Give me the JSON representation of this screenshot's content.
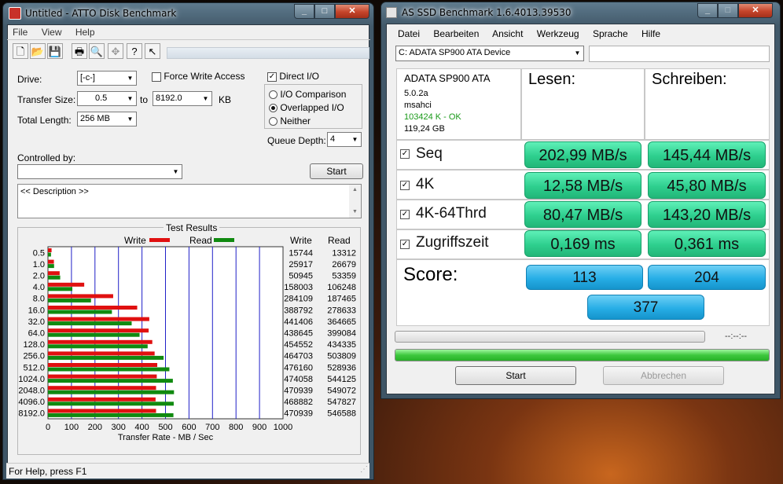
{
  "atto": {
    "title": "Untitled - ATTO Disk Benchmark",
    "menu": [
      "File",
      "View",
      "Help"
    ],
    "drive_label": "Drive:",
    "drive_value": "[-c-]",
    "force_write": "Force Write Access",
    "direct_io": "Direct I/O",
    "transfer_size_label": "Transfer Size:",
    "ts_from": "0.5",
    "ts_to_label": "to",
    "ts_to": "8192.0",
    "ts_unit": "KB",
    "total_length_label": "Total Length:",
    "total_length": "256 MB",
    "io_comparison": "I/O Comparison",
    "overlapped_io": "Overlapped I/O",
    "neither": "Neither",
    "queue_depth_label": "Queue Depth:",
    "queue_depth": "4",
    "controlled_by": "Controlled by:",
    "start": "Start",
    "description": "<< Description >>",
    "results_title": "Test Results",
    "write_legend": "Write",
    "read_legend": "Read",
    "col_write": "Write",
    "col_read": "Read",
    "status": "For Help, press F1",
    "chart_data": {
      "type": "bar",
      "title": "Test Results",
      "xlabel": "Transfer Rate - MB / Sec",
      "xlim": [
        0,
        1000
      ],
      "xticks": [
        "0",
        "100",
        "200",
        "300",
        "400",
        "500",
        "600",
        "700",
        "800",
        "900",
        "1000"
      ],
      "categories": [
        "0.5",
        "1.0",
        "2.0",
        "4.0",
        "8.0",
        "16.0",
        "32.0",
        "64.0",
        "128.0",
        "256.0",
        "512.0",
        "1024.0",
        "2048.0",
        "4096.0",
        "8192.0"
      ],
      "series": [
        {
          "name": "Write",
          "color": "#e01010",
          "values": [
            15744,
            25917,
            50945,
            158003,
            284109,
            388792,
            441406,
            438645,
            454552,
            464703,
            476160,
            474058,
            470939,
            468882,
            470939
          ]
        },
        {
          "name": "Read",
          "color": "#108a10",
          "values": [
            13312,
            26679,
            53359,
            106248,
            187465,
            278633,
            364665,
            399084,
            434335,
            503809,
            528936,
            544125,
            549072,
            547827,
            546588
          ]
        }
      ],
      "write_text": [
        "15744",
        "25917",
        "50945",
        "158003",
        "284109",
        "388792",
        "441406",
        "438645",
        "454552",
        "464703",
        "476160",
        "474058",
        "470939",
        "468882",
        "470939"
      ],
      "read_text": [
        "13312",
        "26679",
        "53359",
        "106248",
        "187465",
        "278633",
        "364665",
        "399084",
        "434335",
        "503809",
        "528936",
        "544125",
        "549072",
        "547827",
        "546588"
      ]
    }
  },
  "asssd": {
    "title": "AS SSD Benchmark 1.6.4013.39530",
    "menu": [
      "Datei",
      "Bearbeiten",
      "Ansicht",
      "Werkzeug",
      "Sprache",
      "Hilfe"
    ],
    "device": "C: ADATA SP900 ATA Device",
    "info_name": "ADATA SP900 ATA",
    "info_fw": "5.0.2a",
    "info_driver": "msahci",
    "info_align": "103424 K - OK",
    "info_size": "119,24 GB",
    "col_read": "Lesen:",
    "col_write": "Schreiben:",
    "rows": [
      {
        "label": "Seq",
        "read": "202,99 MB/s",
        "write": "145,44 MB/s"
      },
      {
        "label": "4K",
        "read": "12,58 MB/s",
        "write": "45,80 MB/s"
      },
      {
        "label": "4K-64Thrd",
        "read": "80,47 MB/s",
        "write": "143,20 MB/s"
      },
      {
        "label": "Zugriffszeit",
        "read": "0,169 ms",
        "write": "0,361 ms"
      }
    ],
    "score_label": "Score:",
    "score_read": "113",
    "score_write": "204",
    "score_total": "377",
    "time": "--:--:--",
    "start": "Start",
    "abort": "Abbrechen",
    "progress_fraction": 1.0,
    "colors": {
      "value_green": "#2ecf8e",
      "score_blue": "#27aee6",
      "ok_green": "#1a9a1a"
    }
  }
}
